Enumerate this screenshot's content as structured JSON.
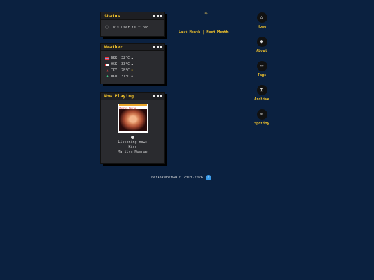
{
  "status": {
    "title": "Status",
    "text": "ⓘ This user is tired."
  },
  "weather": {
    "title": "Weather",
    "rows": [
      {
        "text": "BKK: 32°C",
        "icon": "cloud",
        "flag_colors": [
          "#e33",
          "#fff",
          "#22a"
        ]
      },
      {
        "text": "OSK: 33°C",
        "icon": "cloud",
        "flag_colors": [
          "#fff",
          "#e33",
          "#fff"
        ]
      },
      {
        "text": "TKY: 28°C",
        "icon": "sun",
        "flag_colors": [
          "#c33"
        ]
      },
      {
        "text": "OKN: 31°C",
        "icon": "rain-cloud",
        "flag_colors": [
          "#2a6"
        ]
      }
    ]
  },
  "playing": {
    "title": "Now Playing",
    "cover_text": "Marilyn Monroe",
    "listening_label": "Listening now:",
    "track": "Kiss",
    "artist": "Marilyn Monroe"
  },
  "months": {
    "prev": "Last Month",
    "separator": "|",
    "next": "Next Month"
  },
  "nav": [
    {
      "label": "Home",
      "icon": "home-icon",
      "glyph": "⌂"
    },
    {
      "label": "About",
      "icon": "person-icon",
      "glyph": "●"
    },
    {
      "label": "Tags",
      "icon": "tag-icon",
      "glyph": "▭"
    },
    {
      "label": "Archive",
      "icon": "hourglass-icon",
      "glyph": "⧗"
    },
    {
      "label": "Spotify",
      "icon": "spotify-icon",
      "glyph": "≋"
    }
  ],
  "footer": {
    "text": "keikokaneiwa © 2013-2026"
  },
  "colors": {
    "background": "#0b2140",
    "accent": "#f3c42b",
    "widget": "#2a2b2f"
  }
}
